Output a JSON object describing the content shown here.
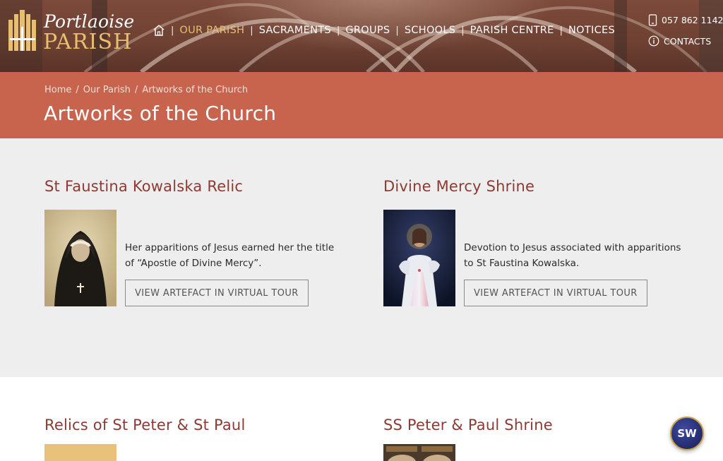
{
  "header": {
    "logo_line1": "Portlaoise",
    "logo_line2": "PARISH",
    "nav": [
      {
        "label": "OUR PARISH",
        "active": true
      },
      {
        "label": "SACRAMENTS",
        "active": false
      },
      {
        "label": "GROUPS",
        "active": false
      },
      {
        "label": "SCHOOLS",
        "active": false
      },
      {
        "label": "PARISH CENTRE",
        "active": false
      },
      {
        "label": "NOTICES",
        "active": false
      }
    ],
    "phone": "057 862 1142",
    "contacts_label": "CONTACTS",
    "icons": {
      "home": "home-icon",
      "phone": "mobile-phone-icon",
      "info": "info-icon"
    }
  },
  "breadcrumb": {
    "items": [
      "Home",
      "Our Parish",
      "Artworks of the Church"
    ],
    "separator": "/"
  },
  "page_title": "Artworks of the Church",
  "cards": [
    {
      "title": "St Faustina Kowalska Relic",
      "description": "Her apparitions of Jesus earned her the title of “Apostle of Divine Mercy”.",
      "button": "VIEW ARTEFACT IN VIRTUAL TOUR"
    },
    {
      "title": "Divine Mercy Shrine",
      "description": "Devotion to Jesus associated with apparitions to St Faustina Kowalska.",
      "button": "VIEW ARTEFACT IN VIRTUAL TOUR"
    },
    {
      "title": "Relics of St Peter & St Paul"
    },
    {
      "title": "SS Peter & Paul Shrine"
    }
  ],
  "badge": {
    "label": "SW"
  },
  "colors": {
    "accent_gold": "#e7bf6e",
    "banner": "#c8644e",
    "title_maroon": "#8c3b33",
    "section_grey": "#eeeeee"
  }
}
